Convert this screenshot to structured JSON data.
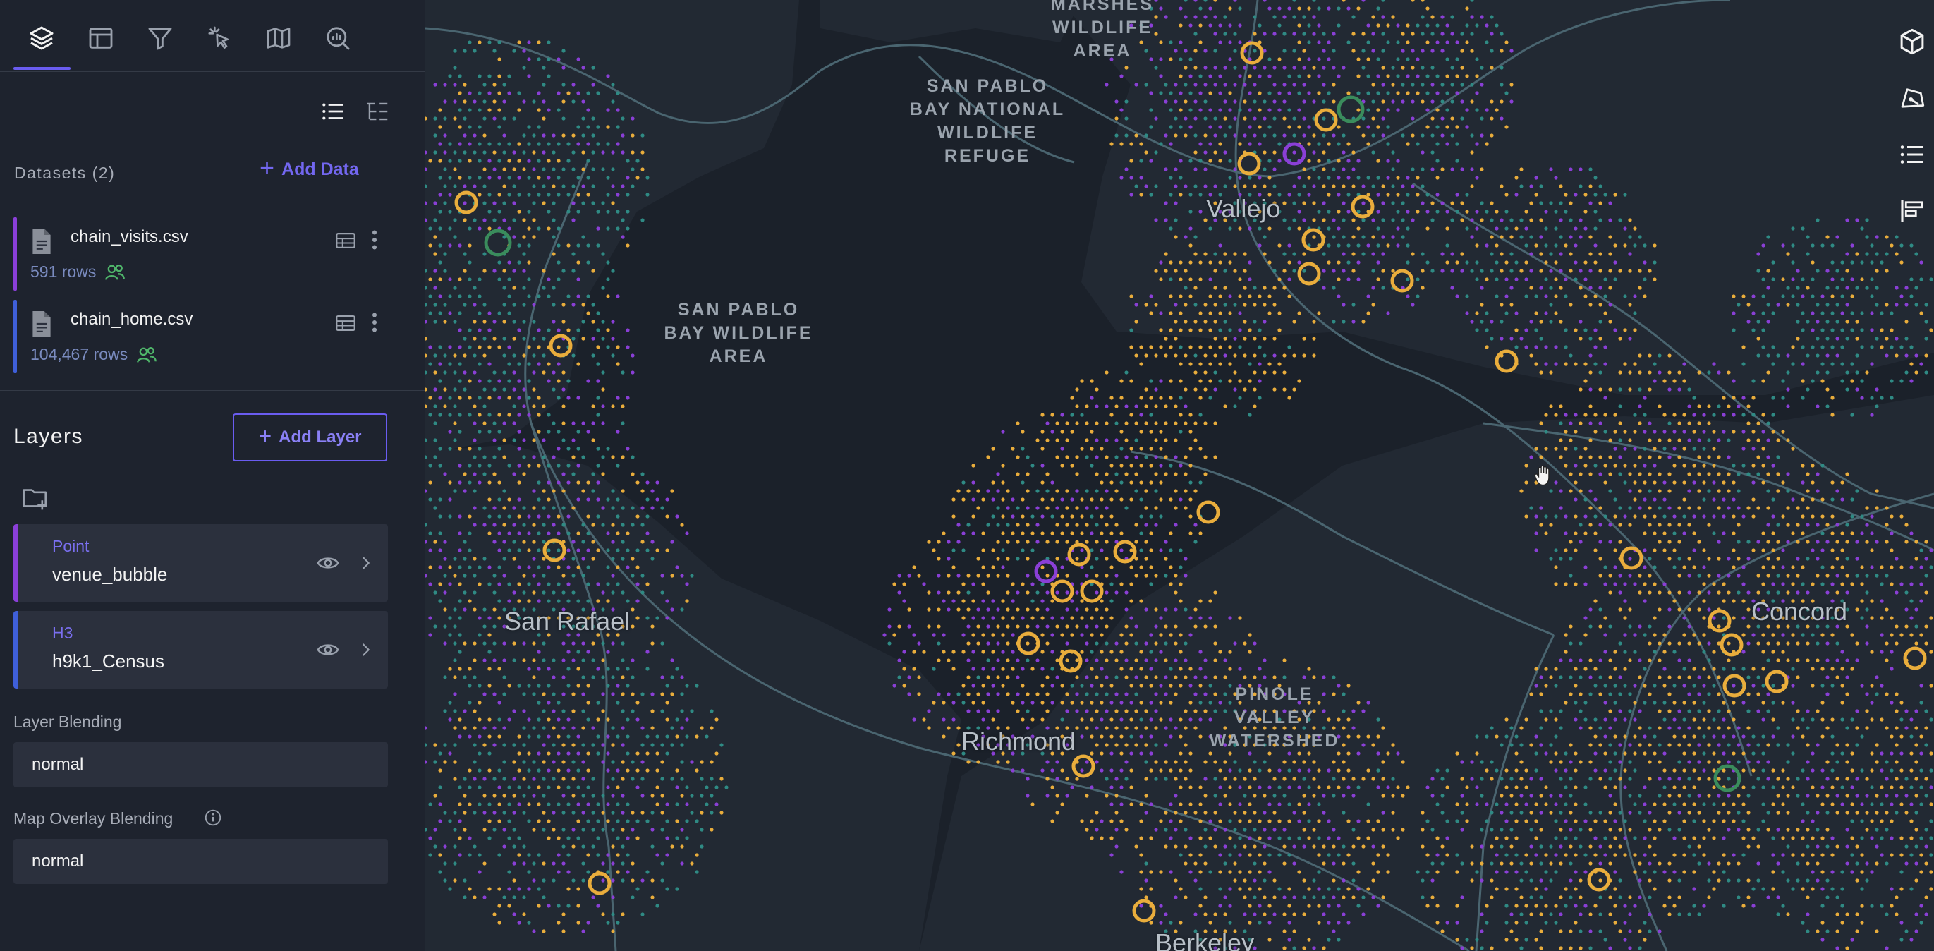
{
  "panel_tabs": [
    {
      "name": "layers",
      "icon": "layers-icon",
      "active": true
    },
    {
      "name": "base-map",
      "icon": "layout-icon",
      "active": false
    },
    {
      "name": "filters",
      "icon": "filter-icon",
      "active": false
    },
    {
      "name": "interactions",
      "icon": "pointer-click-icon",
      "active": false
    },
    {
      "name": "map-style",
      "icon": "map-icon",
      "active": false
    },
    {
      "name": "analysis",
      "icon": "chart-search-icon",
      "active": false
    }
  ],
  "datasets": {
    "title": "Datasets (2)",
    "add_label": "Add Data",
    "items": [
      {
        "name": "chain_visits.csv",
        "rows": "591 rows",
        "color": "#8b3fd9"
      },
      {
        "name": "chain_home.csv",
        "rows": "104,467 rows",
        "color": "#3f5fd9"
      }
    ]
  },
  "layers": {
    "title": "Layers",
    "add_label": "Add Layer",
    "items": [
      {
        "type": "Point",
        "name": "venue_bubble",
        "color": "#8b3fd9"
      },
      {
        "type": "H3",
        "name": "h9k1_Census",
        "color": "#3f5fd9"
      }
    ],
    "layer_blending_label": "Layer Blending",
    "layer_blending_value": "normal",
    "overlay_blending_label": "Map Overlay Blending",
    "overlay_blending_value": "normal"
  },
  "map": {
    "area_labels": [
      "MARSHES\nWILDLIFE\nAREA",
      "SAN PABLO\nBAY NATIONAL\nWILDLIFE\nREFUGE",
      "SAN PABLO\nBAY WILDLIFE\nAREA",
      "PINOLE\nVALLEY\nWATERSHED"
    ],
    "cities": [
      "Vallejo",
      "San Rafael",
      "Richmond",
      "Concord",
      "Berkeley"
    ],
    "colors": {
      "background": "#1a2029",
      "water": "#1b212a",
      "land": "#222933",
      "roads": "#4a6570",
      "teal": "#2f8a84",
      "purple": "#8a3fd6",
      "yellow": "#e9ad3c",
      "green_ring": "#3a8c5c"
    }
  },
  "map_controls": [
    "3d-cube-icon",
    "draw-polygon-icon",
    "legend-list-icon",
    "split-map-icon"
  ]
}
